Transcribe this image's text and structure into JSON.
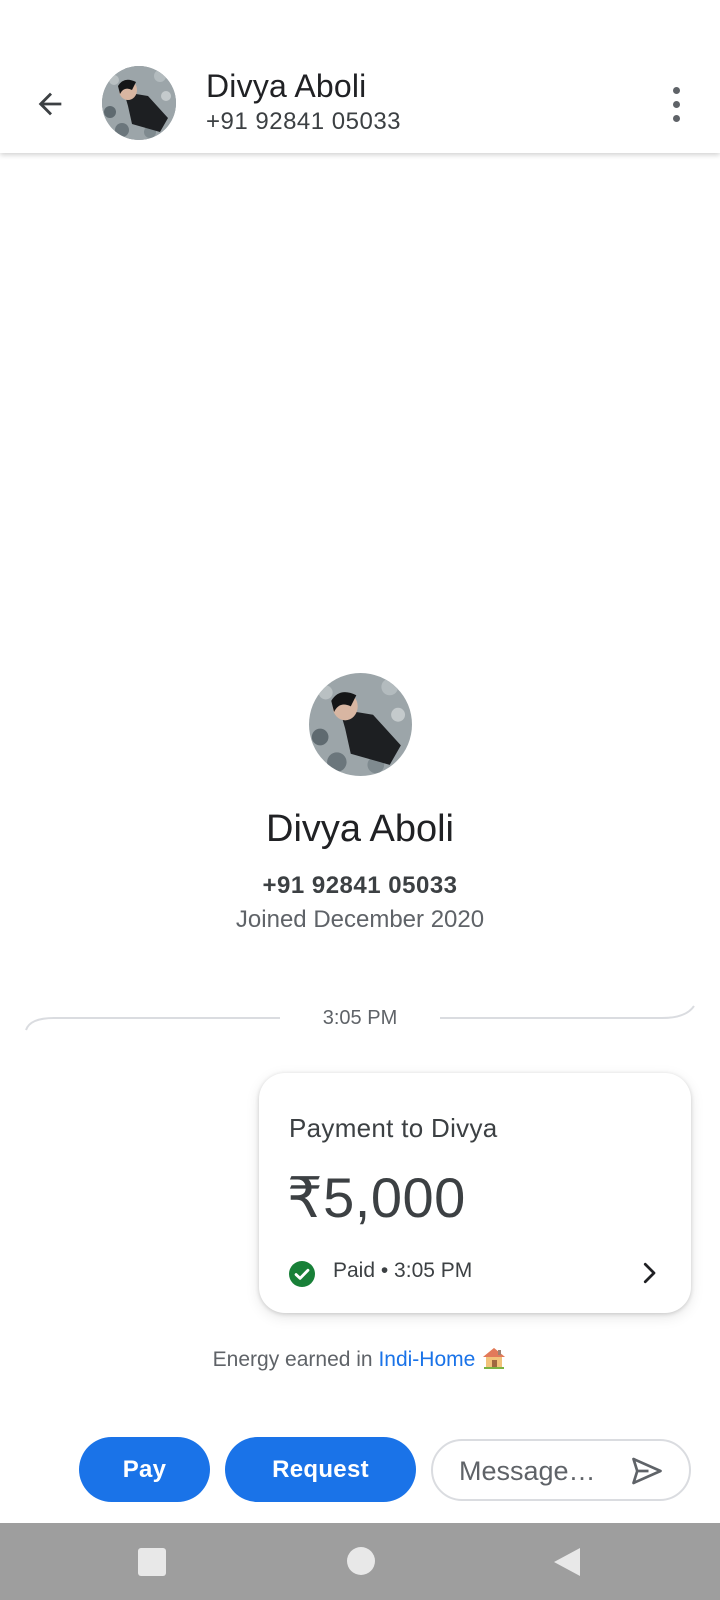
{
  "header": {
    "name": "Divya Aboli",
    "phone": "+91 92841 05033",
    "back_icon": "arrow-left-icon",
    "menu_icon": "more-vert-icon"
  },
  "profile": {
    "name": "Divya Aboli",
    "phone": "+91 92841 05033",
    "joined": "Joined December 2020"
  },
  "timeline": {
    "timestamp": "3:05 PM"
  },
  "payment": {
    "title": "Payment to Divya",
    "amount": "₹5,000",
    "status": "Paid • 3:05 PM",
    "status_icon": "check-circle-icon",
    "status_color": "#188038"
  },
  "energy": {
    "prefix": "Energy earned in ",
    "link": "Indi-Home",
    "icon": "house-icon"
  },
  "actions": {
    "pay_label": "Pay",
    "request_label": "Request",
    "message_placeholder": "Message…",
    "send_icon": "send-icon"
  },
  "colors": {
    "accent": "#1a73e8",
    "success": "#188038",
    "navbar": "#9e9e9e"
  }
}
